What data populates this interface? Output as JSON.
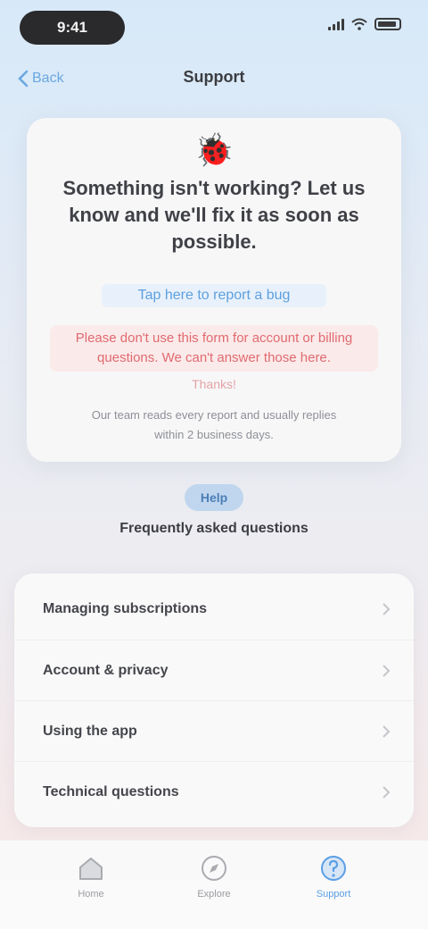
{
  "status_bar": {
    "time": "9:41"
  },
  "nav": {
    "back_label": "Back",
    "title": "Support"
  },
  "hero": {
    "emoji": "🐞",
    "heading": "Something isn't working? Let us know and we'll fix it as soon as possible.",
    "link": "Tap here to report a bug",
    "warning": "Please don't use this form for account or billing questions. We can't answer those here.",
    "warning_tail": "Thanks!",
    "footnote": "Our team reads every report and usually replies within 2 business days."
  },
  "section": {
    "badge": "Help",
    "title": "Frequently asked questions"
  },
  "options": [
    {
      "label": "Managing subscriptions"
    },
    {
      "label": "Account & privacy"
    },
    {
      "label": "Using the app"
    },
    {
      "label": "Technical questions"
    }
  ],
  "tabs": [
    {
      "label": "Home",
      "icon": "home-icon"
    },
    {
      "label": "Explore",
      "icon": "compass-icon"
    },
    {
      "label": "Support",
      "icon": "question-icon",
      "active": true
    }
  ],
  "colors": {
    "accent": "#5b9ee4",
    "warning": "#e06a6f"
  }
}
